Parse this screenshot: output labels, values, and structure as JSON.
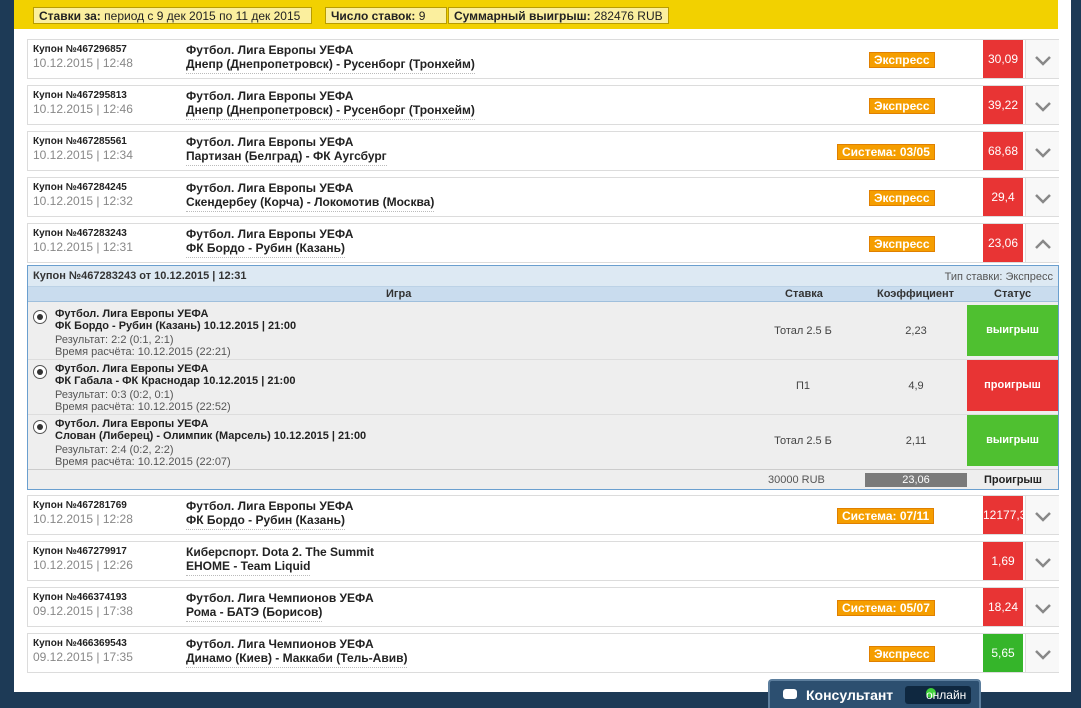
{
  "summary": {
    "period_label": "Ставки за:",
    "period_value": "период с 9 дек 2015 по 11 дек 2015",
    "count_label": "Число ставок:",
    "count_value": "9",
    "winnings_label": "Суммарный выигрыш:",
    "winnings_value": "282476 RUB"
  },
  "coupons": [
    {
      "num": "Купон №467296857",
      "date": "10.12.2015 | 12:48",
      "league": "Футбол. Лига Европы УЕФА",
      "match": "Днепр (Днепропетровск) - Русенборг (Тронхейм)",
      "type": "Экспресс",
      "coef": "30,09",
      "color": "#e83434"
    },
    {
      "num": "Купон №467295813",
      "date": "10.12.2015 | 12:46",
      "league": "Футбол. Лига Европы УЕФА",
      "match": "Днепр (Днепропетровск) - Русенборг (Тронхейм)",
      "type": "Экспресс",
      "coef": "39,22",
      "color": "#e83434"
    },
    {
      "num": "Купон №467285561",
      "date": "10.12.2015 | 12:34",
      "league": "Футбол. Лига Европы УЕФА",
      "match": "Партизан (Белград) - ФК Аугсбург",
      "type": "Система: 03/05",
      "coef": "68,68",
      "color": "#e83434"
    },
    {
      "num": "Купон №467284245",
      "date": "10.12.2015 | 12:32",
      "league": "Футбол. Лига Европы УЕФА",
      "match": "Скендербеу (Корча) - Локомотив (Москва)",
      "type": "Экспресс",
      "coef": "29,4",
      "color": "#e83434"
    },
    {
      "num": "Купон №467283243",
      "date": "10.12.2015 | 12:31",
      "league": "Футбол. Лига Европы УЕФА",
      "match": "ФК Бордо - Рубин (Казань)",
      "type": "Экспресс",
      "coef": "23,06",
      "color": "#e83434"
    },
    {
      "num": "Купон №467281769",
      "date": "10.12.2015 | 12:28",
      "league": "Футбол. Лига Европы УЕФА",
      "match": "ФК Бордо - Рубин (Казань)",
      "type": "Система: 07/11",
      "coef": "12177,3",
      "color": "#e83434"
    },
    {
      "num": "Купон №467279917",
      "date": "10.12.2015 | 12:26",
      "league": "Киберспорт. Dota 2. The Summit",
      "match": "EHOME - Team Liquid",
      "type": "",
      "coef": "1,69",
      "color": "#e83434"
    },
    {
      "num": "Купон №466374193",
      "date": "09.12.2015 | 17:38",
      "league": "Футбол. Лига Чемпионов УЕФА",
      "match": "Рома - БАТЭ (Борисов)",
      "type": "Система: 05/07",
      "coef": "18,24",
      "color": "#e83434"
    },
    {
      "num": "Купон №466369543",
      "date": "09.12.2015 | 17:35",
      "league": "Футбол. Лига Чемпионов УЕФА",
      "match": "Динамо (Киев) - Маккаби (Тель-Авив)",
      "type": "Экспресс",
      "coef": "5,65",
      "color": "#35b52a"
    }
  ],
  "expanded": {
    "title": "Купон №467283243 от 10.12.2015 | 12:31",
    "bet_type": "Тип ставки: Экспресс",
    "columns": {
      "game": "Игра",
      "stake": "Ставка",
      "coef": "Коэффициент",
      "status": "Статус"
    },
    "events": [
      {
        "league": "Футбол. Лига Европы УЕФА",
        "match": "ФК Бордо - Рубин (Казань) 10.12.2015 | 21:00",
        "result": "Результат: 2:2 (0:1, 2:1)",
        "calc": "Время расчёта: 10.12.2015 (22:21)",
        "bet": "Тотал 2.5 Б",
        "coef": "2,23",
        "status": "выигрыш",
        "win": true
      },
      {
        "league": "Футбол. Лига Европы УЕФА",
        "match": "ФК Габала - ФК Краснодар 10.12.2015 | 21:00",
        "result": "Результат: 0:3 (0:2, 0:1)",
        "calc": "Время расчёта: 10.12.2015 (22:52)",
        "bet": "П1",
        "coef": "4,9",
        "status": "проигрыш",
        "win": false
      },
      {
        "league": "Футбол. Лига Европы УЕФА",
        "match": "Слован (Либерец) - Олимпик (Марсель) 10.12.2015 | 21:00",
        "result": "Результат: 2:4 (0:2, 2:2)",
        "calc": "Время расчёта: 10.12.2015 (22:07)",
        "bet": "Тотал 2.5 Б",
        "coef": "2,11",
        "status": "выигрыш",
        "win": true
      }
    ],
    "total_stake": "30000 RUB",
    "total_coef": "23,06",
    "total_status": "Проигрыш"
  },
  "consultant": {
    "title": "Консультант",
    "status": "онлайн"
  },
  "colors": {
    "accent": "#f2d100",
    "win": "#4fc030",
    "lose": "#e83434",
    "badge": "#f59e00"
  }
}
